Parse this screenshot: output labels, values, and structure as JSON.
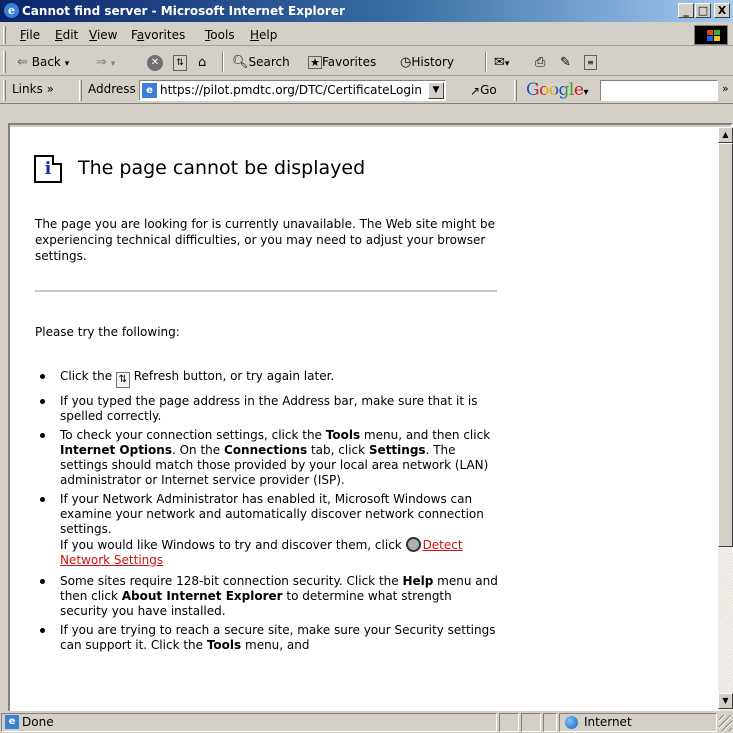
{
  "window": {
    "title": "Cannot find server - Microsoft Internet Explorer",
    "min": "_",
    "max": "□",
    "close": "X"
  },
  "menu": [
    {
      "key": "F",
      "rest": "ile"
    },
    {
      "key": "E",
      "pre": "",
      "rest": "dit"
    },
    {
      "key": "V",
      "rest": "iew"
    },
    {
      "pre": "F",
      "key": "a",
      "rest": "vorites"
    },
    {
      "key": "T",
      "rest": "ools"
    },
    {
      "key": "H",
      "rest": "elp"
    }
  ],
  "toolbar": {
    "back_label": "Back",
    "search_label": "Search",
    "favorites_label": "Favorites",
    "history_label": "History"
  },
  "address": {
    "links_label": "Links »",
    "address_label": "Address",
    "url": "https://pilot.pmdtc.org/DTC/CertificateLogin",
    "go_label": "Go",
    "google_logo": "Google",
    "google_arrow": "▾",
    "overflow": "»"
  },
  "page": {
    "heading": "The page cannot be displayed",
    "intro": "The page you are looking for is currently unavailable. The Web site might be experiencing technical difficulties, or you may need to adjust your browser settings.",
    "try_label": "Please try the following:",
    "tip1_pre": "Click the ",
    "tip1_post": " Refresh button, or try again later.",
    "tip2": "If you typed the page address in the Address bar, make sure that it is spelled correctly.",
    "tip3_a": "To check your connection settings, click the ",
    "tip3_tools": "Tools",
    "tip3_b": " menu, and then click ",
    "tip3_io": "Internet Options",
    "tip3_c": ". On the ",
    "tip3_conn": "Connections",
    "tip3_d": " tab, click ",
    "tip3_settings": "Settings",
    "tip3_e": ". The settings should match those provided by your local area network (LAN) administrator or Internet service provider (ISP).",
    "tip4_a": "If your Network Administrator has enabled it, Microsoft Windows can examine your network and automatically discover network connection settings.",
    "tip4_b": "If you would like Windows to try and discover them, click ",
    "tip4_link": "Detect Network Settings",
    "tip5_a": "Some sites require 128-bit connection security. Click the ",
    "tip5_help": "Help",
    "tip5_b": " menu and then click ",
    "tip5_about": "About Internet Explorer",
    "tip5_c": " to determine what strength security you have installed.",
    "tip6_a": "If you are trying to reach a secure site, make sure your Security settings can support it. Click the ",
    "tip6_tools": "Tools",
    "tip6_b": " menu, and"
  },
  "status": {
    "text": "Done",
    "zone": "Internet"
  }
}
